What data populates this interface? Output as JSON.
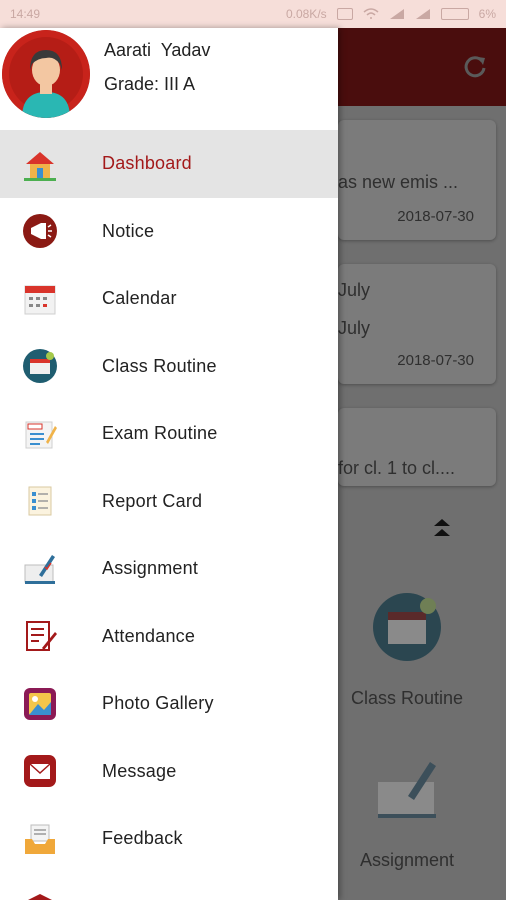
{
  "status_bar": {
    "time": "14:49",
    "speed": "0.08K/s",
    "battery": "6%"
  },
  "drawer": {
    "user_name": "Aarati  Yadav",
    "grade": "Grade: III A",
    "menu": [
      {
        "label": "Dashboard",
        "icon": "house-icon"
      },
      {
        "label": "Notice",
        "icon": "megaphone-icon"
      },
      {
        "label": "Calendar",
        "icon": "calendar-icon"
      },
      {
        "label": "Class Routine",
        "icon": "routine-calendar-icon"
      },
      {
        "label": "Exam Routine",
        "icon": "exam-sheet-icon"
      },
      {
        "label": "Report Card",
        "icon": "report-card-icon"
      },
      {
        "label": "Assignment",
        "icon": "assignment-book-icon"
      },
      {
        "label": "Attendance",
        "icon": "attendance-sheet-icon"
      },
      {
        "label": "Photo Gallery",
        "icon": "photo-gallery-icon"
      },
      {
        "label": "Message",
        "icon": "envelope-icon"
      },
      {
        "label": "Feedback",
        "icon": "inbox-tray-icon"
      }
    ]
  },
  "background": {
    "cards": [
      {
        "title": "as new emis ...",
        "date": "2018-07-30"
      },
      {
        "title1": "July",
        "title2": "July",
        "date": "2018-07-30"
      },
      {
        "title": "for cl. 1 to cl...."
      }
    ],
    "tiles": [
      {
        "label": "Class Routine"
      },
      {
        "label": "Assignment"
      }
    ]
  },
  "colors": {
    "accent": "#a3191a",
    "active_bg": "#e4e4e4",
    "toolbar": "#4a0d0d"
  }
}
